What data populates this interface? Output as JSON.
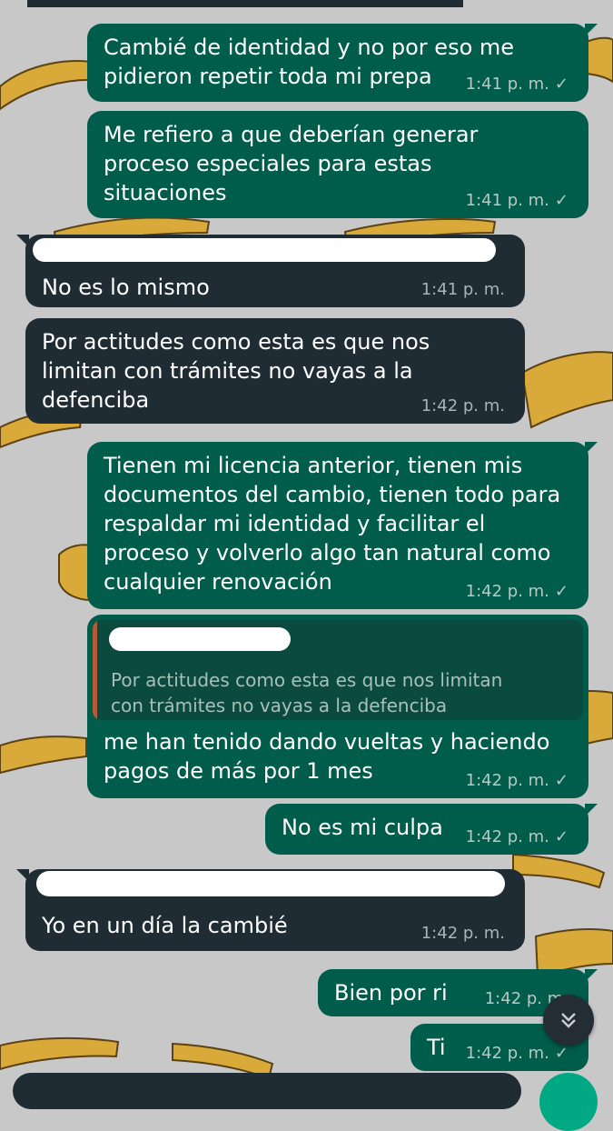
{
  "colors": {
    "outgoing_bubble": "#005c4b",
    "incoming_bubble": "#1f2c34",
    "wallpaper": "#c8c8c8",
    "quote_accent": "#b45b34",
    "send_button": "#00a884"
  },
  "messages": [
    {
      "direction": "outgoing",
      "text": "Cambié de identidad y no por eso me\npidieron repetir toda mi prepa",
      "time": "1:41 p. m.",
      "status": "sent-check-icon"
    },
    {
      "direction": "outgoing",
      "text": "Me refiero a que deberían generar\nproceso especiales para estas\nsituaciones",
      "time": "1:41 p. m.",
      "status": "sent-check-icon"
    },
    {
      "direction": "incoming",
      "text": "No es lo mismo",
      "time": "1:41 p. m."
    },
    {
      "direction": "incoming",
      "text": "Por actitudes como esta es que nos\nlimitan con trámites no vayas a la\ndefenciba",
      "time": "1:42 p. m."
    },
    {
      "direction": "outgoing",
      "text": "Tienen mi licencia anterior, tienen mis\ndocumentos del cambio, tienen todo para\nrespaldar mi identidad y facilitar el\nproceso y volverlo algo tan natural como\ncualquier renovación",
      "time": "1:42 p. m.",
      "status": "sent-check-icon"
    },
    {
      "direction": "outgoing",
      "quote": "Por actitudes como esta es que nos limitan\ncon trámites no vayas a la defenciba",
      "text": "me han tenido dando vueltas y haciendo\npagos de más por 1 mes",
      "time": "1:42 p. m.",
      "status": "sent-check-icon"
    },
    {
      "direction": "outgoing",
      "text": "No es mi culpa",
      "time": "1:42 p. m.",
      "status": "sent-check-icon"
    },
    {
      "direction": "incoming",
      "text": "Yo en un día la cambié",
      "time": "1:42 p. m."
    },
    {
      "direction": "outgoing",
      "text": "Bien por ri",
      "time": "1:42 p. m."
    },
    {
      "direction": "outgoing",
      "text": "Ti",
      "time": "1:42 p. m.",
      "status": "sent-check-icon"
    }
  ],
  "controls": {
    "scroll_down_icon": "double-chevron-down-icon"
  }
}
